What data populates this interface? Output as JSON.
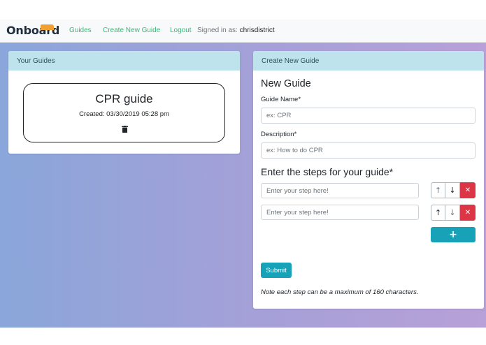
{
  "nav": {
    "brand": "Onboard",
    "links": [
      "Guides",
      "Create New Guide",
      "Logout"
    ],
    "signed_in_prefix": "Signed in as:",
    "username": "chrisdistrict"
  },
  "your_guides": {
    "header": "Your Guides",
    "guides": [
      {
        "title": "CPR guide",
        "created": "Created: 03/30/2019 05:28 pm",
        "delete_icon": "trash-icon"
      }
    ]
  },
  "create_guide": {
    "header": "Create New Guide",
    "title": "New Guide",
    "name_label": "Guide Name*",
    "name_placeholder": "ex: CPR",
    "description_label": "Description*",
    "description_placeholder": "ex: How to do CPR",
    "steps_heading": "Enter the steps for your guide*",
    "steps": [
      {
        "placeholder": "Enter your step here!",
        "value": ""
      },
      {
        "placeholder": "Enter your step here!",
        "value": ""
      }
    ],
    "add_step_label": "+",
    "submit_label": "Submit",
    "note": "Note each step can be a maximum of 160 characters."
  },
  "colors": {
    "accent_link": "#3cb878",
    "header_bg": "#bfe3ec",
    "button_info": "#17a2b8",
    "button_danger": "#dc3545",
    "logo_flag": "#f0a030"
  }
}
